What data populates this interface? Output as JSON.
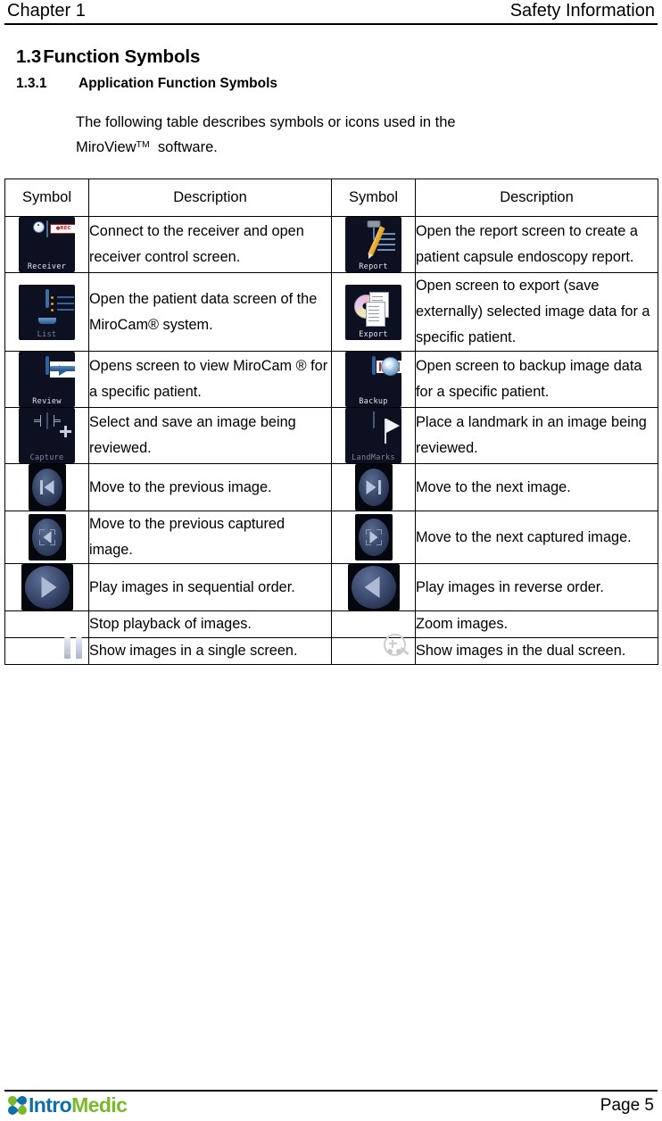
{
  "header": {
    "left": "Chapter 1",
    "right": "Safety Information"
  },
  "headings": {
    "h1_number": "1.3",
    "h1_title": "Function Symbols",
    "h2_number": "1.3.1",
    "h2_title": "Application Function Symbols"
  },
  "intro": {
    "line1": "The following table describes symbols or icons used in the",
    "line2_pre": "MiroView",
    "line2_sup": "TM",
    "line2_post": "software."
  },
  "table": {
    "columns": [
      "Symbol",
      "Description",
      "Symbol",
      "Description"
    ],
    "rows": [
      {
        "left": {
          "icon": "receiver-icon",
          "icon_label": "Receiver",
          "description": "Connect to the receiver and open receiver control screen."
        },
        "right": {
          "icon": "report-icon",
          "icon_label": "Report",
          "description": "Open the report screen to create a patient capsule endoscopy report."
        }
      },
      {
        "left": {
          "icon": "list-icon",
          "icon_label": "List",
          "description": "Open the patient data screen of the MiroCam® system."
        },
        "right": {
          "icon": "export-icon",
          "icon_label": "Export",
          "description": "Open screen to export (save externally) selected image data for a specific patient."
        }
      },
      {
        "left": {
          "icon": "review-icon",
          "icon_label": "Review",
          "description": "Opens screen to view MiroCam ® for a specific patient."
        },
        "right": {
          "icon": "backup-icon",
          "icon_label": "Backup",
          "description": "Open screen to backup image data for a specific patient."
        }
      },
      {
        "left": {
          "icon": "capture-icon",
          "icon_label": "Capture",
          "description": "Select and save an image being reviewed."
        },
        "right": {
          "icon": "landmarks-icon",
          "icon_label": "LandMarks",
          "description": "Place a landmark in an image being reviewed."
        }
      },
      {
        "left": {
          "icon": "previous-image-icon",
          "icon_label": "",
          "description": "Move to the previous image."
        },
        "right": {
          "icon": "next-image-icon",
          "icon_label": "",
          "description": "Move to the next image."
        }
      },
      {
        "left": {
          "icon": "previous-captured-image-icon",
          "icon_label": "",
          "description": "Move to the previous captured image."
        },
        "right": {
          "icon": "next-captured-image-icon",
          "icon_label": "",
          "description": "Move to the next captured image."
        }
      },
      {
        "left": {
          "icon": "play-forward-icon",
          "icon_label": "",
          "description": "Play images in sequential order."
        },
        "right": {
          "icon": "play-reverse-icon",
          "icon_label": "",
          "description": "Play images in reverse order."
        }
      },
      {
        "left": {
          "icon": "pause-icon",
          "icon_label": "",
          "description": "Stop playback of images."
        },
        "right": {
          "icon": "zoom-icon",
          "icon_label": "",
          "description": "Zoom images."
        }
      },
      {
        "left": {
          "icon": "single-screen-icon",
          "icon_label": "",
          "description": "Show images in a single screen."
        },
        "right": {
          "icon": "dual-screen-icon",
          "icon_label": "",
          "description": "Show images in the dual screen."
        }
      }
    ]
  },
  "footer": {
    "logo_part1": "Intro",
    "logo_part2": "Medic",
    "page": "Page 5"
  },
  "colors": {
    "logo_blue": "#0d6fa8",
    "logo_green": "#7ab929",
    "rule": "#000000"
  }
}
